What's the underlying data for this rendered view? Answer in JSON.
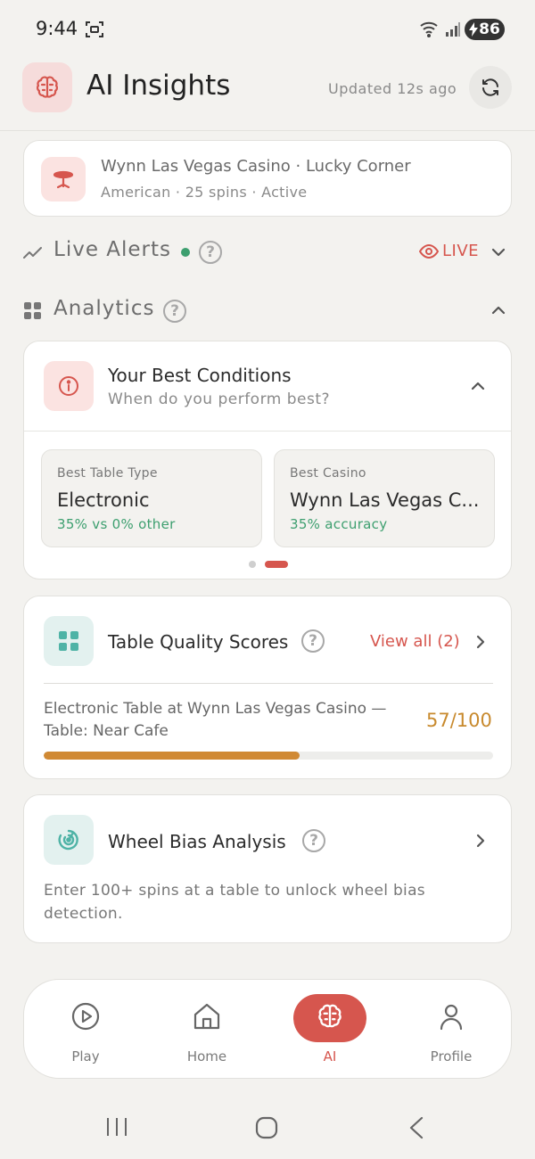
{
  "status_bar": {
    "time": "9:44",
    "battery": "86"
  },
  "header": {
    "title": "AI Insights",
    "updated": "Updated 12s ago"
  },
  "session": {
    "name": "Wynn Las Vegas Casino · Lucky Corner",
    "meta": "American · 25 spins · Active"
  },
  "live_alerts": {
    "label": "Live Alerts",
    "help": "?",
    "live_label": "LIVE"
  },
  "analytics": {
    "label": "Analytics",
    "help": "?"
  },
  "best_conditions": {
    "title": "Your Best Conditions",
    "subtitle": "When do you perform best?",
    "stats": [
      {
        "label": "Best Table Type",
        "value": "Electronic",
        "detail": "35% vs 0% other"
      },
      {
        "label": "Best Casino",
        "value": "Wynn Las Vegas C...",
        "detail": "35% accuracy"
      }
    ]
  },
  "table_quality": {
    "title": "Table Quality Scores",
    "help": "?",
    "view_all": "View all (2)",
    "description": "Electronic Table at Wynn Las Vegas Casino — Table: Near Cafe",
    "score": "57/100",
    "progress_fraction": 0.57
  },
  "wheel_bias": {
    "title": "Wheel Bias Analysis",
    "help": "?",
    "description": "Enter 100+ spins at a table to unlock wheel bias detection."
  },
  "bottom_nav": {
    "items": [
      {
        "label": "Play",
        "icon": "play-circle-icon"
      },
      {
        "label": "Home",
        "icon": "home-icon"
      },
      {
        "label": "AI",
        "icon": "brain-icon",
        "active": true
      },
      {
        "label": "Profile",
        "icon": "person-icon"
      }
    ]
  },
  "colors": {
    "accent_red": "#d6564e",
    "success_green": "#3d9f6f",
    "score_amber": "#d08934",
    "background": "#f3f2ef"
  }
}
